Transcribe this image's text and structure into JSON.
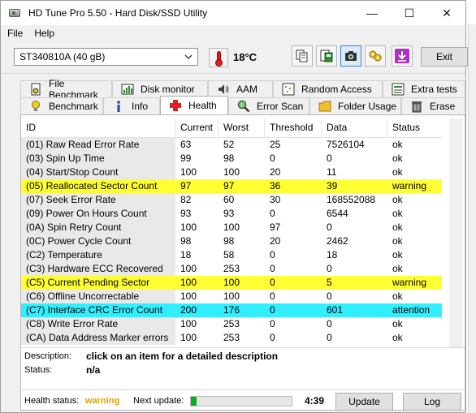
{
  "window": {
    "title": "HD Tune Pro 5.50 - Hard Disk/SSD Utility",
    "min_glyph": "—",
    "max_glyph": "☐",
    "close_glyph": "✕"
  },
  "menu": [
    "File",
    "Help"
  ],
  "toolbar": {
    "drive": "ST340810A (40 gB)",
    "temperature": "18°C",
    "exit_label": "Exit",
    "buttons": [
      "copy-icon",
      "save-icon",
      "camera-icon",
      "options-icon",
      "download-icon"
    ]
  },
  "background_fragments": [
    "kt",
    "t",
    "t",
    "t",
    "ld",
    "O",
    "ti",
    "o",
    "r"
  ],
  "tabs": {
    "row1": [
      "File Benchmark",
      "Disk monitor",
      "AAM",
      "Random Access",
      "Extra tests"
    ],
    "row2": [
      "Benchmark",
      "Info",
      "Health",
      "Error Scan",
      "Folder Usage",
      "Erase"
    ],
    "selected": "Health"
  },
  "grid": {
    "columns": [
      "ID",
      "Current",
      "Worst",
      "Threshold",
      "Data",
      "Status"
    ],
    "rows": [
      {
        "id": "(01) Raw Read Error Rate",
        "current": "63",
        "worst": "52",
        "threshold": "25",
        "data": "7526104",
        "status": "ok",
        "level": "ok"
      },
      {
        "id": "(03) Spin Up Time",
        "current": "99",
        "worst": "98",
        "threshold": "0",
        "data": "0",
        "status": "ok",
        "level": "ok"
      },
      {
        "id": "(04) Start/Stop Count",
        "current": "100",
        "worst": "100",
        "threshold": "20",
        "data": "11",
        "status": "ok",
        "level": "ok"
      },
      {
        "id": "(05) Reallocated Sector Count",
        "current": "97",
        "worst": "97",
        "threshold": "36",
        "data": "39",
        "status": "warning",
        "level": "warning"
      },
      {
        "id": "(07) Seek Error Rate",
        "current": "82",
        "worst": "60",
        "threshold": "30",
        "data": "168552088",
        "status": "ok",
        "level": "ok"
      },
      {
        "id": "(09) Power On Hours Count",
        "current": "93",
        "worst": "93",
        "threshold": "0",
        "data": "6544",
        "status": "ok",
        "level": "ok"
      },
      {
        "id": "(0A) Spin Retry Count",
        "current": "100",
        "worst": "100",
        "threshold": "97",
        "data": "0",
        "status": "ok",
        "level": "ok"
      },
      {
        "id": "(0C) Power Cycle Count",
        "current": "98",
        "worst": "98",
        "threshold": "20",
        "data": "2462",
        "status": "ok",
        "level": "ok"
      },
      {
        "id": "(C2) Temperature",
        "current": "18",
        "worst": "58",
        "threshold": "0",
        "data": "18",
        "status": "ok",
        "level": "ok"
      },
      {
        "id": "(C3) Hardware ECC Recovered",
        "current": "100",
        "worst": "253",
        "threshold": "0",
        "data": "0",
        "status": "ok",
        "level": "ok"
      },
      {
        "id": "(C5) Current Pending Sector",
        "current": "100",
        "worst": "100",
        "threshold": "0",
        "data": "5",
        "status": "warning",
        "level": "warning"
      },
      {
        "id": "(C6) Offline Uncorrectable",
        "current": "100",
        "worst": "100",
        "threshold": "0",
        "data": "0",
        "status": "ok",
        "level": "ok"
      },
      {
        "id": "(C7) Interface CRC Error Count",
        "current": "200",
        "worst": "176",
        "threshold": "0",
        "data": "601",
        "status": "attention",
        "level": "attention"
      },
      {
        "id": "(C8) Write Error Rate",
        "current": "100",
        "worst": "253",
        "threshold": "0",
        "data": "0",
        "status": "ok",
        "level": "ok"
      },
      {
        "id": "(CA) Data Address Marker errors",
        "current": "100",
        "worst": "253",
        "threshold": "0",
        "data": "0",
        "status": "ok",
        "level": "ok"
      }
    ]
  },
  "details": {
    "description_label": "Description:",
    "description_value": "click on an item for a detailed description",
    "status_label": "Status:",
    "status_value": "n/a"
  },
  "statusbar": {
    "health_label": "Health status:",
    "health_value": "warning",
    "next_update_label": "Next update:",
    "progress_fraction": 0.06,
    "timer": "4:39",
    "update_label": "Update",
    "log_label": "Log"
  },
  "colors": {
    "warning_row": "#ffff33",
    "attention_row": "#33eeff",
    "health_warning_text": "#e0a000",
    "progress_fill": "#06b025"
  }
}
